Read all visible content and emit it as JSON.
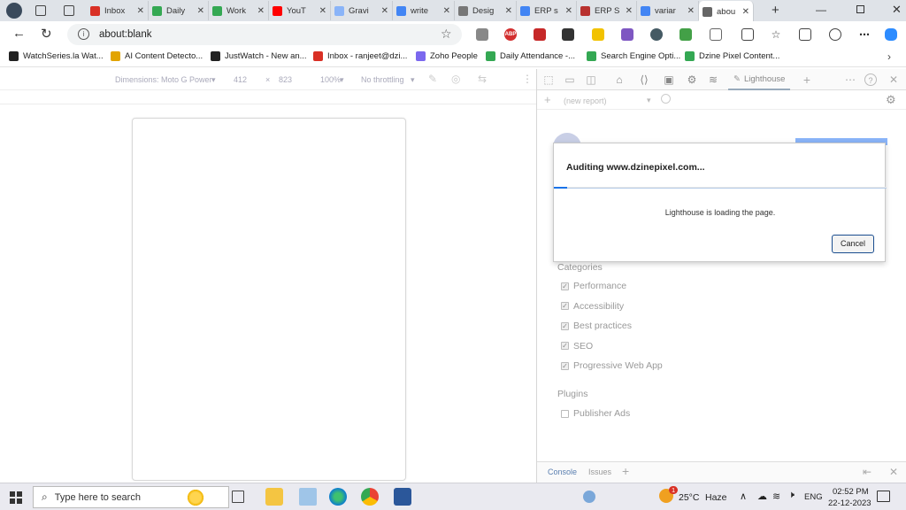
{
  "browser": {
    "tabs": [
      {
        "label": "Inbox",
        "icon": "gmail-icon",
        "color": "#d93025"
      },
      {
        "label": "Daily",
        "icon": "sheets-icon",
        "color": "#34a853"
      },
      {
        "label": "Work",
        "icon": "sheets-icon",
        "color": "#34a853"
      },
      {
        "label": "YouT",
        "icon": "youtube-icon",
        "color": "#ff0000"
      },
      {
        "label": "Gravi",
        "icon": "gravatar-icon",
        "color": "#8ab4f8"
      },
      {
        "label": "write",
        "icon": "google-icon",
        "color": "#4285f4"
      },
      {
        "label": "Desig",
        "icon": "page-icon",
        "color": "#777777"
      },
      {
        "label": "ERP s",
        "icon": "google-icon",
        "color": "#4285f4"
      },
      {
        "label": "ERP S",
        "icon": "erp-icon",
        "color": "#b8312f"
      },
      {
        "label": "variar",
        "icon": "google-icon",
        "color": "#4285f4"
      },
      {
        "label": "abou",
        "icon": "page-icon",
        "color": "#666666",
        "active": true
      }
    ],
    "address": {
      "url": "about:blank"
    },
    "bookmarks": [
      {
        "label": "WatchSeries.la  Wat...",
        "icon": "watchseries-icon",
        "color": "#222222"
      },
      {
        "label": "AI Content Detecto...",
        "icon": "bookmark-icon",
        "color": "#e2a400"
      },
      {
        "label": "JustWatch - New an...",
        "icon": "justwatch-icon",
        "color": "#222222"
      },
      {
        "label": "Inbox - ranjeet@dzi...",
        "icon": "gmail-icon",
        "color": "#d93025"
      },
      {
        "label": "Zoho People",
        "icon": "zoho-icon",
        "color": "#7b68ee"
      },
      {
        "label": "Daily Attendance -...",
        "icon": "sheets-icon",
        "color": "#34a853"
      },
      {
        "label": "Search Engine Opti...",
        "icon": "sheets-icon",
        "color": "#34a853"
      },
      {
        "label": "Dzine Pixel Content...",
        "icon": "sheets-icon",
        "color": "#34a853"
      }
    ]
  },
  "device_toolbar": {
    "dimensions_label": "Dimensions: Moto G Power",
    "width": "412",
    "times": "×",
    "height": "823",
    "zoom": "100%",
    "throttling": "No throttling"
  },
  "devtools": {
    "active_tab": "Lighthouse",
    "report_select": "(new report)",
    "categories_title": "Categories",
    "categories": [
      {
        "label": "Performance",
        "checked": true
      },
      {
        "label": "Accessibility",
        "checked": true
      },
      {
        "label": "Best practices",
        "checked": true
      },
      {
        "label": "SEO",
        "checked": true
      },
      {
        "label": "Progressive Web App",
        "checked": true
      }
    ],
    "plugins_title": "Plugins",
    "plugins": [
      {
        "label": "Publisher Ads",
        "checked": false
      }
    ],
    "bottom_tabs": [
      "Console",
      "Issues"
    ]
  },
  "dialog": {
    "title": "Auditing www.dzinepixel.com...",
    "message": "Lighthouse is loading the page.",
    "cancel_label": "Cancel",
    "progress": 0.04
  },
  "taskbar": {
    "search_placeholder": "Type here to search",
    "weather_temp": "25°C",
    "weather_desc": "Haze",
    "weather_badge": "1",
    "language": "ENG",
    "time": "02:52 PM",
    "date": "22-12-2023"
  }
}
